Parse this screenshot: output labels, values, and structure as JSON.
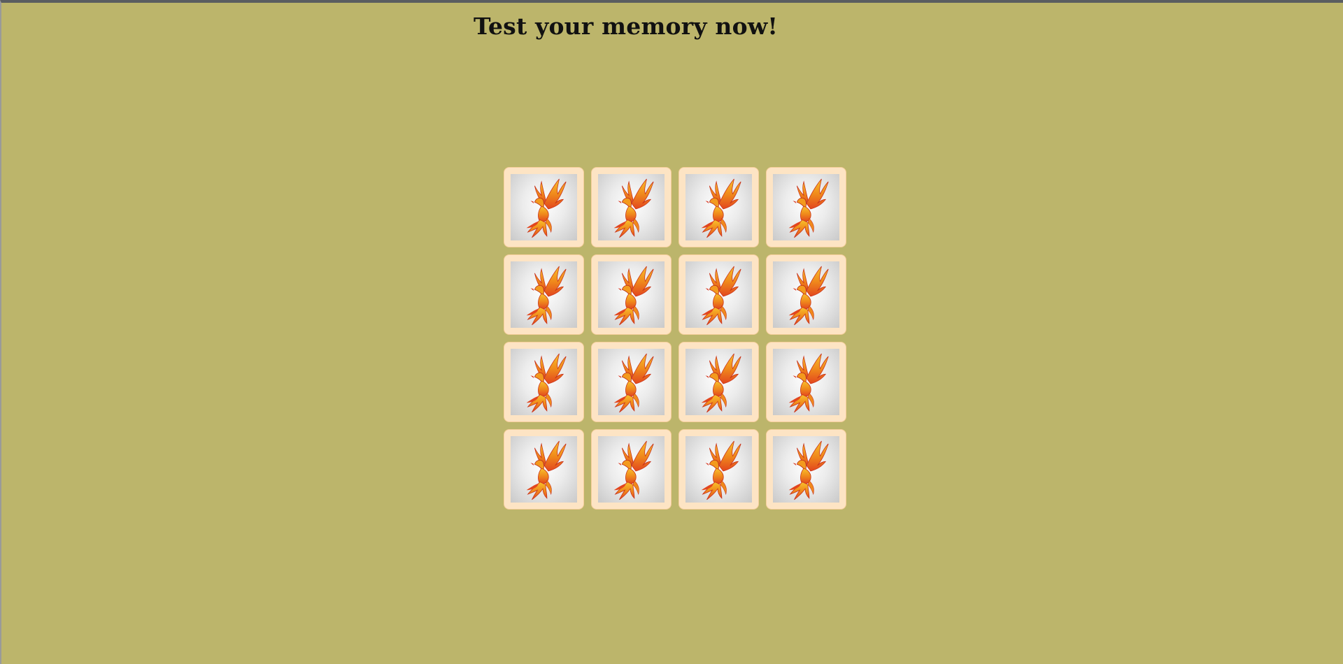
{
  "page": {
    "title": "Test your memory now!"
  },
  "colors": {
    "background": "#bcb56b",
    "card_border": "#fde4c4",
    "card_face": "#e6e6e6",
    "phoenix_primary": "#f39a1e",
    "phoenix_accent": "#d8321b"
  },
  "board": {
    "rows": 4,
    "columns": 4,
    "cards": [
      {
        "state": "face-down",
        "icon": "phoenix-icon"
      },
      {
        "state": "face-down",
        "icon": "phoenix-icon"
      },
      {
        "state": "face-down",
        "icon": "phoenix-icon"
      },
      {
        "state": "face-down",
        "icon": "phoenix-icon"
      },
      {
        "state": "face-down",
        "icon": "phoenix-icon"
      },
      {
        "state": "face-down",
        "icon": "phoenix-icon"
      },
      {
        "state": "face-down",
        "icon": "phoenix-icon"
      },
      {
        "state": "face-down",
        "icon": "phoenix-icon"
      },
      {
        "state": "face-down",
        "icon": "phoenix-icon"
      },
      {
        "state": "face-down",
        "icon": "phoenix-icon"
      },
      {
        "state": "face-down",
        "icon": "phoenix-icon"
      },
      {
        "state": "face-down",
        "icon": "phoenix-icon"
      },
      {
        "state": "face-down",
        "icon": "phoenix-icon"
      },
      {
        "state": "face-down",
        "icon": "phoenix-icon"
      },
      {
        "state": "face-down",
        "icon": "phoenix-icon"
      },
      {
        "state": "face-down",
        "icon": "phoenix-icon"
      }
    ]
  }
}
